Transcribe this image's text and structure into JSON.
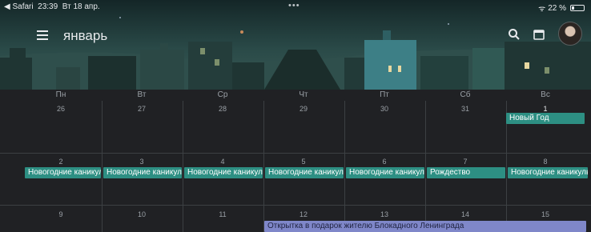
{
  "status_bar": {
    "back_app": "◀ Safari",
    "time": "23:39",
    "date": "Вт 18 апр.",
    "dots": "•••",
    "wifi": "ᯤ",
    "battery": "22 %"
  },
  "header": {
    "month": "январь",
    "icons": [
      "menu-icon",
      "search-icon",
      "calendar-today-icon",
      "avatar"
    ]
  },
  "weekdays": [
    "Пн",
    "Вт",
    "Ср",
    "Чт",
    "Пт",
    "Сб",
    "Вс"
  ],
  "weeks": [
    {
      "days": [
        "26",
        "27",
        "28",
        "29",
        "30",
        "31",
        "1"
      ]
    },
    {
      "days": [
        "2",
        "3",
        "4",
        "5",
        "6",
        "7",
        "8"
      ]
    },
    {
      "days": [
        "9",
        "10",
        "11",
        "12",
        "13",
        "14",
        "15"
      ]
    }
  ],
  "events": {
    "new_year": "Новый Год",
    "holidays": [
      "Новогодние каникулы",
      "Новогодние каникулы",
      "Новогодние каникулы",
      "Новогодние каникулы",
      "Новогодние каникулы"
    ],
    "christmas": "Рождество",
    "holiday_sun": "Новогодние каникулы",
    "leningrad": "Открытка в подарок жителю Блокадного Ленинграда"
  },
  "colors": {
    "event_green": "#2d8f83",
    "event_purple": "#7f87c9",
    "background": "#202124"
  }
}
